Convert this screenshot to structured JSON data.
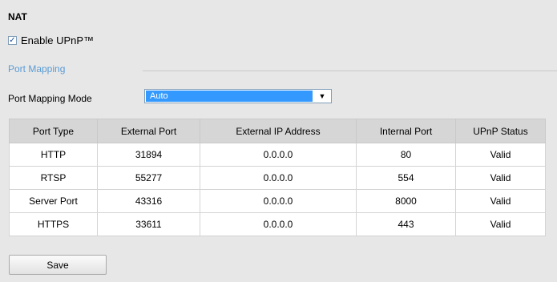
{
  "section_title": "NAT",
  "upnp": {
    "label": "Enable UPnP™",
    "checked": true,
    "check_glyph": "✓"
  },
  "port_mapping": {
    "title": "Port Mapping",
    "mode_label": "Port Mapping Mode",
    "mode_value": "Auto",
    "arrow": "▼"
  },
  "table": {
    "headers": [
      "Port Type",
      "External Port",
      "External IP Address",
      "Internal Port",
      "UPnP Status"
    ],
    "rows": [
      [
        "HTTP",
        "31894",
        "0.0.0.0",
        "80",
        "Valid"
      ],
      [
        "RTSP",
        "55277",
        "0.0.0.0",
        "554",
        "Valid"
      ],
      [
        "Server Port",
        "43316",
        "0.0.0.0",
        "8000",
        "Valid"
      ],
      [
        "HTTPS",
        "33611",
        "0.0.0.0",
        "443",
        "Valid"
      ]
    ]
  },
  "save_label": "Save",
  "colors": {
    "accent": "#5a9bd5",
    "select_highlight": "#3399ff",
    "background": "#e7e7e7"
  }
}
